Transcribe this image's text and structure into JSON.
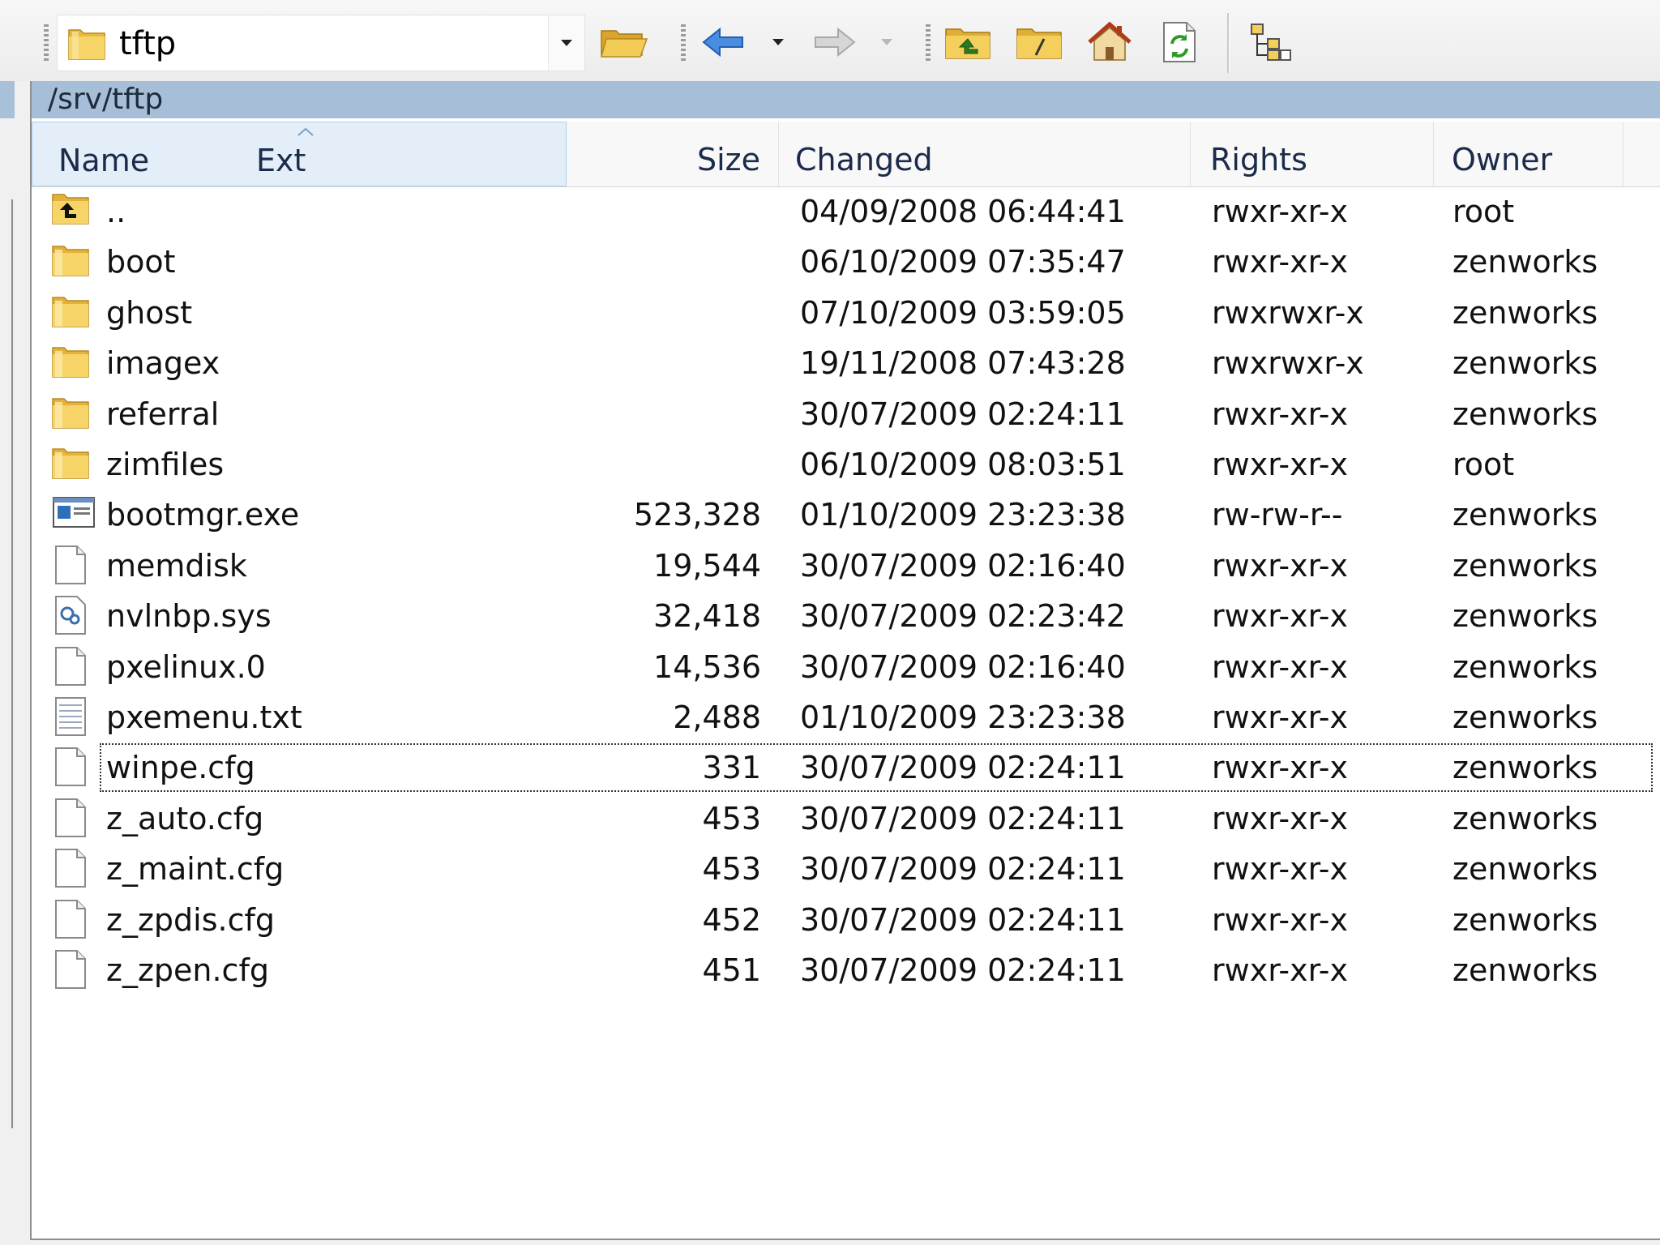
{
  "toolbar": {
    "location": "tftp",
    "icons": [
      "folder-icon",
      "dropdown-arrow-icon",
      "open-folder-icon",
      "back-arrow-icon",
      "forward-arrow-icon",
      "parent-directory-icon",
      "root-directory-icon",
      "home-icon",
      "refresh-icon",
      "tree-view-icon"
    ]
  },
  "panel": {
    "path": "/srv/tftp"
  },
  "columns": {
    "name": "Name",
    "ext": "Ext",
    "size": "Size",
    "changed": "Changed",
    "rights": "Rights",
    "owner": "Owner"
  },
  "files": [
    {
      "icon": "parent-folder",
      "name": "..",
      "size": "",
      "changed": "04/09/2008 06:44:41",
      "rights": "rwxr-xr-x",
      "owner": "root"
    },
    {
      "icon": "folder",
      "name": "boot",
      "size": "",
      "changed": "06/10/2009 07:35:47",
      "rights": "rwxr-xr-x",
      "owner": "zenworks"
    },
    {
      "icon": "folder",
      "name": "ghost",
      "size": "",
      "changed": "07/10/2009 03:59:05",
      "rights": "rwxrwxr-x",
      "owner": "zenworks"
    },
    {
      "icon": "folder",
      "name": "imagex",
      "size": "",
      "changed": "19/11/2008 07:43:28",
      "rights": "rwxrwxr-x",
      "owner": "zenworks"
    },
    {
      "icon": "folder",
      "name": "referral",
      "size": "",
      "changed": "30/07/2009 02:24:11",
      "rights": "rwxr-xr-x",
      "owner": "zenworks"
    },
    {
      "icon": "folder",
      "name": "zimfiles",
      "size": "",
      "changed": "06/10/2009 08:03:51",
      "rights": "rwxr-xr-x",
      "owner": "root"
    },
    {
      "icon": "exe",
      "name": "bootmgr.exe",
      "size": "523,328",
      "changed": "01/10/2009 23:23:38",
      "rights": "rw-rw-r--",
      "owner": "zenworks"
    },
    {
      "icon": "file",
      "name": "memdisk",
      "size": "19,544",
      "changed": "30/07/2009 02:16:40",
      "rights": "rwxr-xr-x",
      "owner": "zenworks"
    },
    {
      "icon": "sys",
      "name": "nvlnbp.sys",
      "size": "32,418",
      "changed": "30/07/2009 02:23:42",
      "rights": "rwxr-xr-x",
      "owner": "zenworks"
    },
    {
      "icon": "file",
      "name": "pxelinux.0",
      "size": "14,536",
      "changed": "30/07/2009 02:16:40",
      "rights": "rwxr-xr-x",
      "owner": "zenworks"
    },
    {
      "icon": "txt",
      "name": "pxemenu.txt",
      "size": "2,488",
      "changed": "01/10/2009 23:23:38",
      "rights": "rwxr-xr-x",
      "owner": "zenworks"
    },
    {
      "icon": "file",
      "name": "winpe.cfg",
      "size": "331",
      "changed": "30/07/2009 02:24:11",
      "rights": "rwxr-xr-x",
      "owner": "zenworks",
      "focused": true
    },
    {
      "icon": "file",
      "name": "z_auto.cfg",
      "size": "453",
      "changed": "30/07/2009 02:24:11",
      "rights": "rwxr-xr-x",
      "owner": "zenworks"
    },
    {
      "icon": "file",
      "name": "z_maint.cfg",
      "size": "453",
      "changed": "30/07/2009 02:24:11",
      "rights": "rwxr-xr-x",
      "owner": "zenworks"
    },
    {
      "icon": "file",
      "name": "z_zpdis.cfg",
      "size": "452",
      "changed": "30/07/2009 02:24:11",
      "rights": "rwxr-xr-x",
      "owner": "zenworks"
    },
    {
      "icon": "file",
      "name": "z_zpen.cfg",
      "size": "451",
      "changed": "30/07/2009 02:24:11",
      "rights": "rwxr-xr-x",
      "owner": "zenworks"
    }
  ],
  "colors": {
    "path_bar": "#a6bed8",
    "folder": "#f2c94c",
    "back_arrow": "#3b7bd4"
  }
}
